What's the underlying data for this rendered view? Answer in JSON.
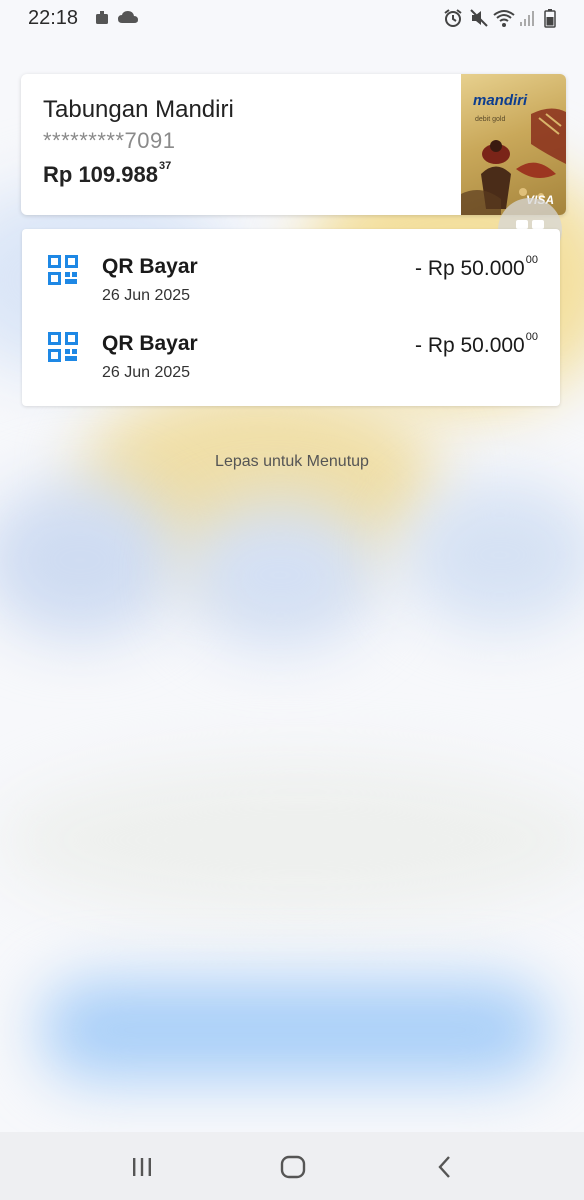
{
  "status_bar": {
    "time": "22:18",
    "icons": [
      "notification-icon",
      "cloud-icon",
      "alarm-icon",
      "mute-icon",
      "wifi-icon",
      "signal-icon",
      "battery-icon"
    ]
  },
  "account": {
    "name": "Tabungan Mandiri",
    "number": "*********7091",
    "balance_main": "Rp 109.988",
    "balance_cents": "37",
    "card": {
      "brand": "mandiri",
      "type": "debit gold",
      "network": "VISA"
    }
  },
  "transactions": [
    {
      "title": "QR Bayar",
      "date": "26 Jun 2025",
      "amount_main": "- Rp 50.000",
      "amount_cents": "00"
    },
    {
      "title": "QR Bayar",
      "date": "26 Jun 2025",
      "amount_main": "- Rp 50.000",
      "amount_cents": "00"
    }
  ],
  "hint": "Lepas untuk Menutup",
  "nav": {
    "recents": "recents-icon",
    "home": "home-icon",
    "back": "back-icon"
  },
  "colors": {
    "accent_blue": "#1e88e5",
    "card_gold": "#c9a85a",
    "brand_navy": "#0d3d8f"
  }
}
